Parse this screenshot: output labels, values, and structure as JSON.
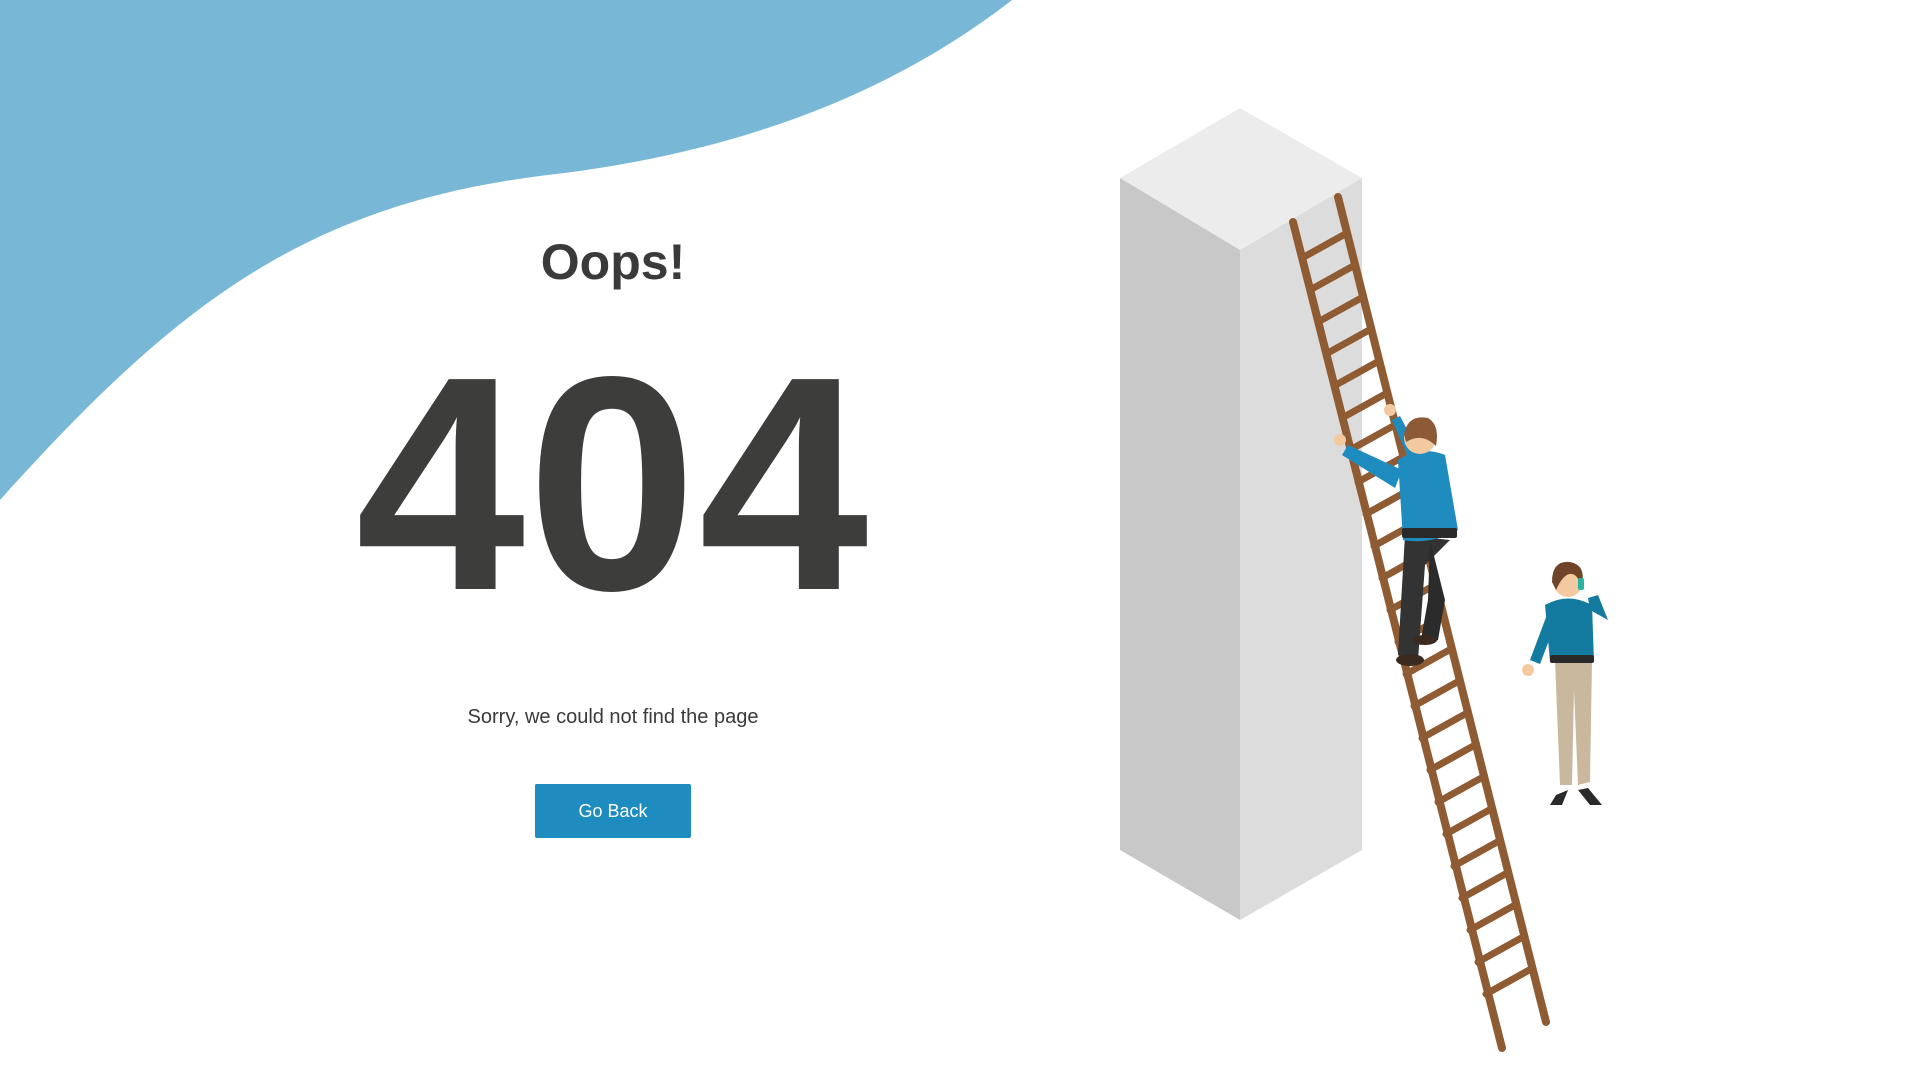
{
  "heading": "Oops!",
  "error_code": "404",
  "message": "Sorry, we could not find the page",
  "go_back_label": "Go Back",
  "colors": {
    "accent_blue": "#1f8cc0",
    "blob_blue": "#78b8d6",
    "text_dark": "#3d3d3b",
    "ladder_brown": "#8f5b33"
  },
  "illustration": {
    "subject": "two people beside a tall pillar, one climbing a ladder"
  }
}
